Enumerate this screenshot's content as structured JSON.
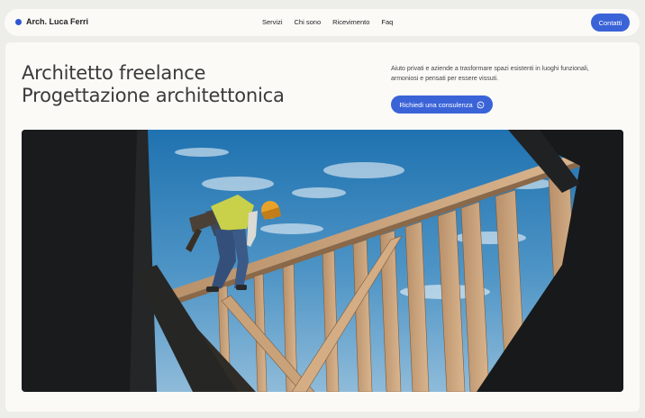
{
  "header": {
    "brand": "Arch. Luca Ferri",
    "nav": [
      "Servizi",
      "Chi sono",
      "Ricevimento",
      "Faq"
    ],
    "contact_label": "Contatti"
  },
  "hero": {
    "title_line1": "Architetto freelance",
    "title_line2": "Progettazione architettonica",
    "description": "Aiuto privati e aziende a trasformare spazi esistenti in luoghi funzionali, armoniosi e pensati per essere vissuti.",
    "cta_label": "Richiedi una consulenza",
    "cta_icon": "whatsapp-icon",
    "image_subject": "worker-on-timber-frame"
  },
  "colors": {
    "accent": "#3a63d8",
    "background": "#ededea",
    "surface": "#fbfaf7"
  }
}
